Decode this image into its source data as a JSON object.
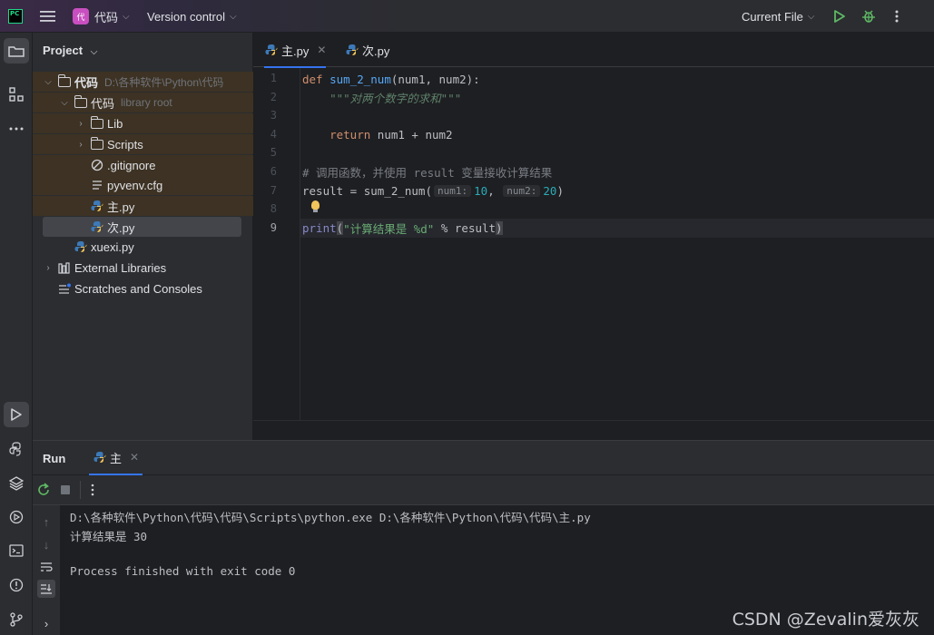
{
  "titlebar": {
    "project_badge": "代",
    "project_name": "代码",
    "version_control": "Version control",
    "run_config": "Current File"
  },
  "project_panel": {
    "title": "Project",
    "tree": [
      {
        "label": "代码",
        "hint": "D:\\各种软件\\Python\\代码",
        "type": "folder",
        "bold": true
      },
      {
        "label": "代码",
        "hint": "library root",
        "type": "folder"
      },
      {
        "label": "Lib",
        "type": "folder"
      },
      {
        "label": "Scripts",
        "type": "folder"
      },
      {
        "label": ".gitignore",
        "type": "ignore"
      },
      {
        "label": "pyvenv.cfg",
        "type": "config"
      },
      {
        "label": "主.py",
        "type": "python"
      },
      {
        "label": "次.py",
        "type": "python",
        "selected": true
      },
      {
        "label": "xuexi.py",
        "type": "python"
      },
      {
        "label": "External Libraries",
        "type": "libraries"
      },
      {
        "label": "Scratches and Consoles",
        "type": "scratches"
      }
    ]
  },
  "editor": {
    "tabs": [
      {
        "label": "主.py",
        "active": true
      },
      {
        "label": "次.py",
        "active": false
      }
    ],
    "line_numbers": [
      "1",
      "2",
      "3",
      "4",
      "5",
      "6",
      "7",
      "8",
      "9"
    ],
    "current_line": "9",
    "code": {
      "l1_def": "def",
      "l1_name": "sum_2_num",
      "l1_rest": "(num1, num2):",
      "l2_doc": "    \"\"\"对两个数字的求和\"\"\"",
      "l4_return": "    return",
      "l4_rest": " num1 + num2",
      "l6_comment": "# 调用函数，并使用 result 变量接收计算结果",
      "l7_start": "result = sum_2_num(",
      "l7_hint1": "num1:",
      "l7_val1": "10",
      "l7_comma": ", ",
      "l7_hint2": "num2:",
      "l7_val2": "20",
      "l7_end": ")",
      "l9_print": "print",
      "l9_open": "(",
      "l9_str": "\"计算结果是 %d\"",
      "l9_rest": " % result",
      "l9_close": ")"
    }
  },
  "run_panel": {
    "title": "Run",
    "tab_label": "主",
    "console": [
      "D:\\各种软件\\Python\\代码\\代码\\Scripts\\python.exe D:\\各种软件\\Python\\代码\\代码\\主.py",
      "计算结果是 30",
      "",
      "Process finished with exit code 0"
    ]
  },
  "watermark": "CSDN @Zevalin爱灰灰",
  "colors": {
    "accent": "#3574f0",
    "run_green": "#5fb865",
    "keyword": "#cf8e6d",
    "function": "#56a8f5",
    "number": "#2aacb8",
    "string": "#6aab73"
  },
  "icons": [
    "hamburger-menu-icon",
    "play-icon",
    "debug-bug-icon",
    "more-vertical-icon",
    "folder-icon",
    "structure-icon",
    "python-icon",
    "rerun-icon",
    "stop-icon"
  ]
}
